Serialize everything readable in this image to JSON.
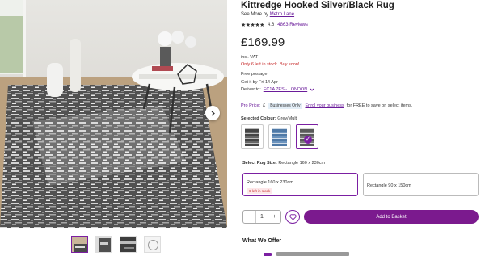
{
  "product": {
    "title": "Kittredge Hooked Silver/Black Rug",
    "see_more_prefix": "See More by",
    "brand": "Metro Lane",
    "stars": "★★★★★",
    "rating": "4.6",
    "reviews": "4863 Reviews",
    "price": "£169.99",
    "vat": "incl. VAT",
    "stock": "Only 6 left in stock. Buy soon!"
  },
  "delivery": {
    "postage": "Free postage",
    "get_by": "Get it by Fri 14 Apr",
    "deliver_to_label": "Deliver to:",
    "location": "EC1A 7ES - LONDON"
  },
  "pro": {
    "label": "Pro Price:",
    "currency": "£",
    "badge": "Businesses Only",
    "enrol_link": "Enrol your business",
    "suffix": "for FREE to save on select items."
  },
  "colour": {
    "label": "Selected Colour:",
    "value": "Grey/Multi",
    "swatch_colors": [
      "#555555",
      "#5b7fa8",
      "#6d6d6d"
    ]
  },
  "size": {
    "label": "Select Rug Size:",
    "value": "Rectangle 160 x 230cm",
    "options": [
      {
        "name": "Rectangle 160 x 230cm",
        "stock": "6 left in stock"
      },
      {
        "name": "Rectangle 90 x 150cm"
      }
    ]
  },
  "basket": {
    "qty_minus": "−",
    "qty_value": "1",
    "qty_plus": "+",
    "add_label": "Add to Basket"
  },
  "offer": {
    "title": "What We Offer"
  },
  "icons": {
    "next": "chevron-right-icon",
    "wishlist": "heart-icon",
    "location": "chevron-down-icon",
    "selected": "check-icon"
  }
}
